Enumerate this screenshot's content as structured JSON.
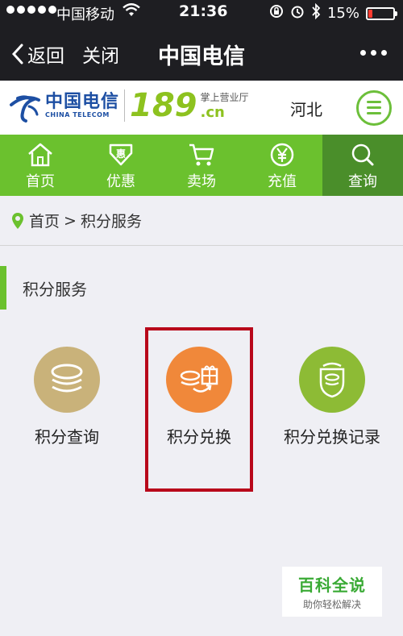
{
  "status_bar": {
    "carrier": "中国移动",
    "time": "21:36",
    "battery": "15%",
    "battery_level": 0.15
  },
  "nav": {
    "back_label": "返回",
    "close_label": "关闭",
    "title": "中国电信"
  },
  "brand": {
    "cn_name": "中国电信",
    "en_name": "CHINA TELECOM",
    "number": "189",
    "tagline": "掌上营业厅",
    "domain": ".cn",
    "region": "河北"
  },
  "tabs": [
    {
      "label": "首页",
      "icon": "home-icon"
    },
    {
      "label": "优惠",
      "icon": "discount-icon"
    },
    {
      "label": "卖场",
      "icon": "cart-icon"
    },
    {
      "label": "充值",
      "icon": "yuan-icon"
    },
    {
      "label": "查询",
      "icon": "search-icon",
      "active": true
    }
  ],
  "breadcrumb": {
    "home": "首页",
    "separator": ">",
    "current": "积分服务"
  },
  "section": {
    "title": "积分服务"
  },
  "services": [
    {
      "label": "积分查询",
      "icon": "coins-stack-icon",
      "color": "#c9b27a"
    },
    {
      "label": "积分兑换",
      "icon": "coins-gift-icon",
      "color": "#f0883a"
    },
    {
      "label": "积分兑换记录",
      "icon": "record-icon",
      "color": "#8dbb35"
    }
  ],
  "highlight_color": "#b8071a",
  "accent": "#6bc12e",
  "watermark": {
    "title": "百科全说",
    "subtitle": "助你轻松解决"
  }
}
